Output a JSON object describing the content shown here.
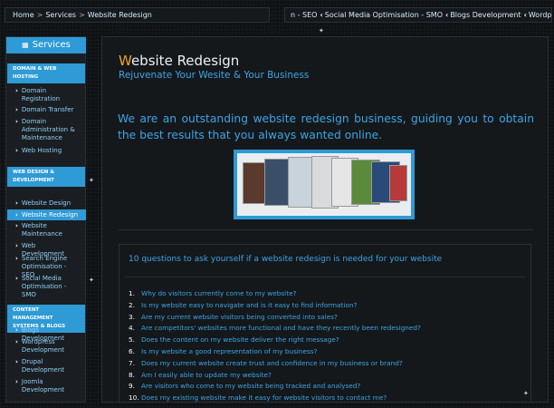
{
  "breadcrumb": {
    "items": [
      "Home",
      "Services",
      "Website Redesign"
    ],
    "separator": ">"
  },
  "topnav": {
    "items": [
      "n - SEO",
      "Social Media Optimisation - SMO",
      "Blogs Development",
      "Wordpress"
    ]
  },
  "sidebar": {
    "title": "Services",
    "categories": [
      {
        "label": "DOMAIN & WEB HOSTING",
        "items": [
          "Domain Registration",
          "Domain Transfer",
          "Domain Administration & Maintenance",
          "Web Hosting"
        ]
      },
      {
        "label": "WEB DESIGN & DEVELOPMENT",
        "items": [
          "Website Design",
          "Website Redesign",
          "Website Maintenance",
          "Web Development",
          "Search Engine Optimisation - SEO",
          "Social Media Optimisation - SMO"
        ]
      },
      {
        "label": "CONTENT MANAGEMENT SYSTEMS & BLOGS",
        "items": [
          "Blogs Development",
          "Wordpress Development",
          "Drupal Development",
          "Joomla Development"
        ]
      }
    ],
    "active_item": "Website Redesign"
  },
  "main": {
    "title_first_letter": "W",
    "title_rest": "ebsite Redesign",
    "subtitle": "Rejuvenate Your Wesite & Your Business",
    "intro": "We are an outstanding website redesign business, guiding you to obtain the best results that you always wanted online.",
    "questions_title": "10 questions to ask yourself if a website redesign is needed for your website",
    "questions": [
      {
        "num": "1.",
        "text": "Why do visitors currently come to my website?"
      },
      {
        "num": "2.",
        "text": "Is my website easy to navigate and is it easy to find information?"
      },
      {
        "num": "3.",
        "text": "Are my current website visitors being converted into sales?"
      },
      {
        "num": "4.",
        "text": "Are competitors' websites more functional and have they recently been redesigned?"
      },
      {
        "num": "5.",
        "text": "Does the content on my website deliver the right message?"
      },
      {
        "num": "6.",
        "text": "Is my website a good representation of my business?"
      },
      {
        "num": "7.",
        "text": "Does my current website create trust and confidence in my business or brand?"
      },
      {
        "num": "8.",
        "text": "Am I easily able to update my website?"
      },
      {
        "num": "9.",
        "text": "Are visitors who come to my website being tracked and analysed?"
      },
      {
        "num": "10.",
        "text": "Does my existing website make it easy for website visitors to contact me?"
      }
    ]
  },
  "colors": {
    "accent": "#2e9ad6",
    "link": "#3fa4e4",
    "title_highlight": "#f0a626",
    "background": "#0e1114"
  }
}
